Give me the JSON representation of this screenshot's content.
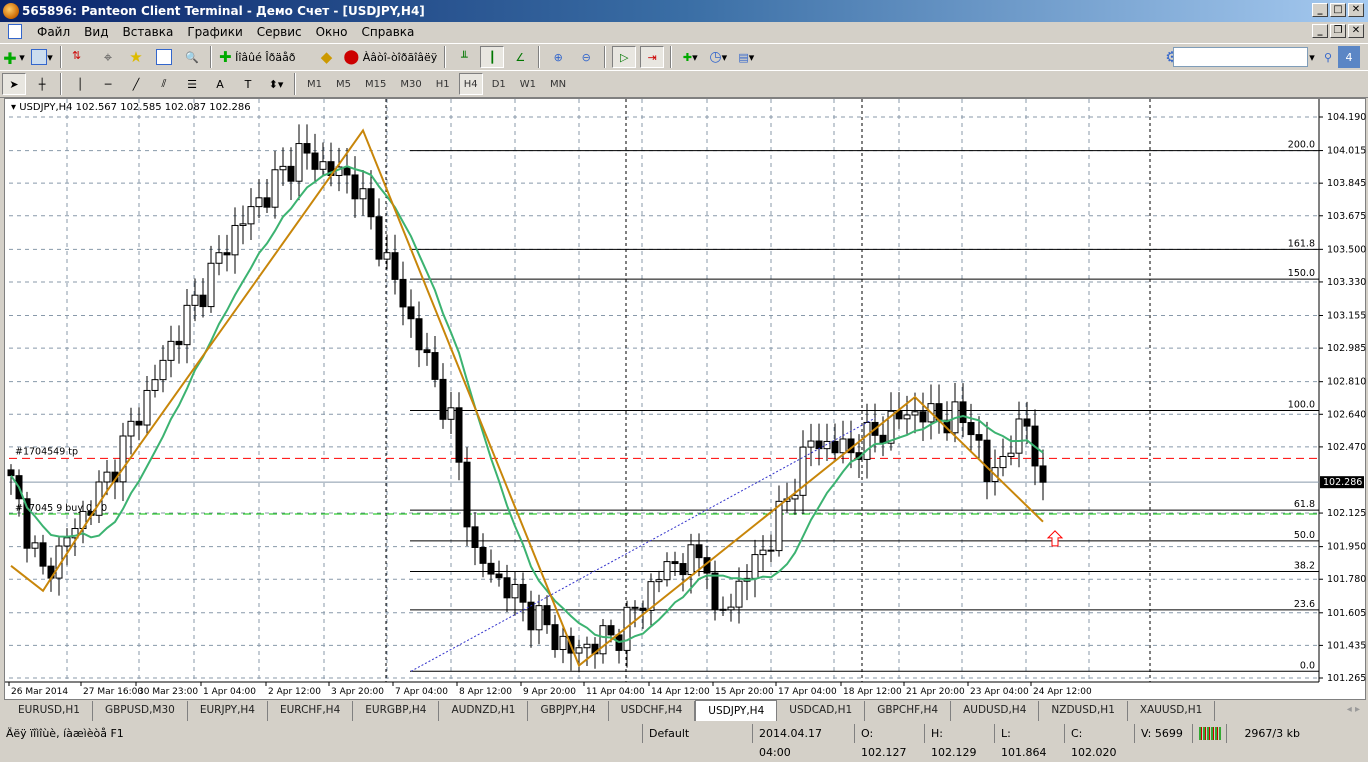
{
  "window": {
    "title": "565896: Panteon Client Terminal - Демо Счет - [USDJPY,H4]"
  },
  "menu": [
    "Файл",
    "Вид",
    "Вставка",
    "Графики",
    "Сервис",
    "Окно",
    "Справка"
  ],
  "toolbar": {
    "new_order": "Íîâûé Îðäåð",
    "experts": "Àâòî-òîðãîâëÿ",
    "notifications_count": "4",
    "search_placeholder": ""
  },
  "timeframes": [
    "M1",
    "M5",
    "M15",
    "M30",
    "H1",
    "H4",
    "D1",
    "W1",
    "MN"
  ],
  "active_timeframe": "H4",
  "chart": {
    "header": "USDJPY,H4  102.567 102.585 102.087 102.286",
    "order_labels": [
      "#1704549 tp",
      "#17045 9 buy 0.20"
    ],
    "current_price": "102.286",
    "price_ticks": [
      "104.190",
      "104.015",
      "103.845",
      "103.675",
      "103.500",
      "103.330",
      "103.155",
      "102.985",
      "102.810",
      "102.640",
      "102.470",
      "102.125",
      "101.950",
      "101.780",
      "101.605",
      "101.435",
      "101.265"
    ],
    "time_ticks": [
      "26 Mar 2014",
      "27 Mar 16:00",
      "30 Mar 23:00",
      "1 Apr 04:00",
      "2 Apr 12:00",
      "3 Apr 20:00",
      "7 Apr 04:00",
      "8 Apr 12:00",
      "9 Apr 20:00",
      "11 Apr 04:00",
      "14 Apr 12:00",
      "15 Apr 20:00",
      "17 Apr 04:00",
      "18 Apr 12:00",
      "21 Apr 20:00",
      "23 Apr 04:00",
      "24 Apr 12:00"
    ],
    "fib_levels": [
      {
        "label": "200.0",
        "price": 104.015
      },
      {
        "label": "161.8",
        "price": 103.5
      },
      {
        "label": "150.0",
        "price": 103.345
      },
      {
        "label": "100.0",
        "price": 102.66
      },
      {
        "label": "61.8",
        "price": 102.14
      },
      {
        "label": "50.0",
        "price": 101.98
      },
      {
        "label": "38.2",
        "price": 101.82
      },
      {
        "label": "23.6",
        "price": 101.62
      },
      {
        "label": "0.0",
        "price": 101.3
      }
    ],
    "tp_price": 102.41,
    "entry_price": 102.12,
    "colors": {
      "zigzag": "#c8860a",
      "ma": "#3cb371",
      "tp": "#ff0000",
      "entry": "#00c000",
      "arrow": "#ff0000"
    }
  },
  "chart_data": {
    "type": "candlestick",
    "symbol": "USDJPY",
    "timeframe": "H4",
    "ylim": [
      101.265,
      104.19
    ],
    "price_path": [
      [
        0,
        102.28
      ],
      [
        4,
        101.8
      ],
      [
        12,
        102.3
      ],
      [
        20,
        103.0
      ],
      [
        28,
        103.6
      ],
      [
        36,
        104.0
      ],
      [
        43,
        103.85
      ],
      [
        55,
        102.6
      ],
      [
        58,
        101.9
      ],
      [
        70,
        101.4
      ],
      [
        76,
        101.5
      ],
      [
        82,
        101.85
      ],
      [
        87,
        101.9
      ],
      [
        88,
        101.55
      ],
      [
        95,
        102.0
      ],
      [
        100,
        102.5
      ],
      [
        105,
        102.45
      ],
      [
        112,
        102.65
      ],
      [
        120,
        102.6
      ],
      [
        122,
        102.3
      ],
      [
        127,
        102.6
      ],
      [
        129,
        102.29
      ]
    ],
    "zigzag": [
      [
        0,
        101.85
      ],
      [
        4,
        101.72
      ],
      [
        12,
        102.24
      ],
      [
        44,
        104.12
      ],
      [
        71,
        101.33
      ],
      [
        113,
        102.73
      ],
      [
        129,
        102.08
      ]
    ],
    "trendline": [
      [
        50,
        101.3
      ],
      [
        108,
        102.62
      ]
    ]
  },
  "tabs": [
    "EURUSD,H1",
    "GBPUSD,M30",
    "EURJPY,H4",
    "EURCHF,H4",
    "EURGBP,H4",
    "AUDNZD,H1",
    "GBPJPY,H4",
    "USDCHF,H4",
    "USDJPY,H4",
    "USDCAD,H1",
    "GBPCHF,H4",
    "AUDUSD,H4",
    "NZDUSD,H1",
    "XAUUSD,H1"
  ],
  "active_tab": "USDJPY,H4",
  "status": {
    "help": "Äëÿ ïîìîùè, íàæìèòå F1",
    "profile": "Default",
    "datetime": "2014.04.17 04:00",
    "open": "O: 102.127",
    "high": "H: 102.129",
    "low": "L: 101.864",
    "close": "C: 102.020",
    "volume": "V: 5699",
    "traffic": "2967/3 kb"
  }
}
